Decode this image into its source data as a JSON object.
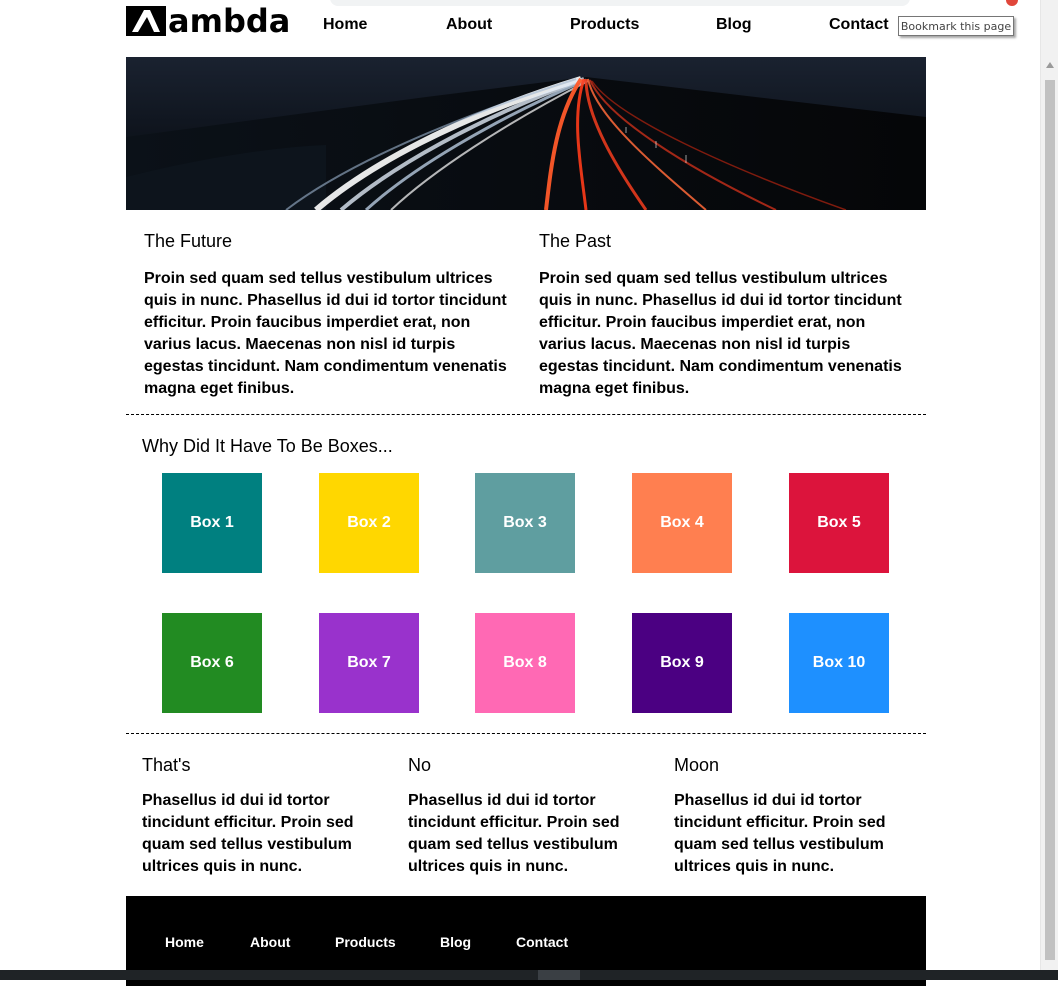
{
  "tooltip": "Bookmark this page",
  "logo": {
    "text": "ambda"
  },
  "nav": {
    "items": [
      "Home",
      "About",
      "Products",
      "Blog",
      "Contact"
    ]
  },
  "intro": {
    "left": {
      "title": "The Future",
      "text": "Proin sed quam sed tellus vestibulum ultrices quis in nunc. Phasellus id dui id tortor tincidunt efficitur. Proin faucibus imperdiet erat, non varius lacus. Maecenas non nisl id turpis egestas tincidunt. Nam condimentum venenatis magna eget finibus."
    },
    "right": {
      "title": "The Past",
      "text": "Proin sed quam sed tellus vestibulum ultrices quis in nunc. Phasellus id dui id tortor tincidunt efficitur. Proin faucibus imperdiet erat, non varius lacus. Maecenas non nisl id turpis egestas tincidunt. Nam condimentum venenatis magna eget finibus."
    }
  },
  "boxes": {
    "title": "Why Did It Have To Be Boxes...",
    "items": [
      {
        "label": "Box 1",
        "color": "#008080"
      },
      {
        "label": "Box 2",
        "color": "#FFD700"
      },
      {
        "label": "Box 3",
        "color": "#5F9EA0"
      },
      {
        "label": "Box 4",
        "color": "#FF7F50"
      },
      {
        "label": "Box 5",
        "color": "#DC143C"
      },
      {
        "label": "Box 6",
        "color": "#228B22"
      },
      {
        "label": "Box 7",
        "color": "#9932CC"
      },
      {
        "label": "Box 8",
        "color": "#FF69B4"
      },
      {
        "label": "Box 9",
        "color": "#4B0082"
      },
      {
        "label": "Box 10",
        "color": "#1E90FF"
      }
    ]
  },
  "columns": [
    {
      "title": "That's",
      "text": "Phasellus id dui id tortor tincidunt efficitur. Proin sed quam sed tellus vestibulum ultrices quis in nunc."
    },
    {
      "title": "No",
      "text": "Phasellus id dui id tortor tincidunt efficitur. Proin sed quam sed tellus vestibulum ultrices quis in nunc."
    },
    {
      "title": "Moon",
      "text": "Phasellus id dui id tortor tincidunt efficitur. Proin sed quam sed tellus vestibulum ultrices quis in nunc."
    }
  ],
  "footer": {
    "items": [
      "Home",
      "About",
      "Products",
      "Blog",
      "Contact"
    ]
  }
}
